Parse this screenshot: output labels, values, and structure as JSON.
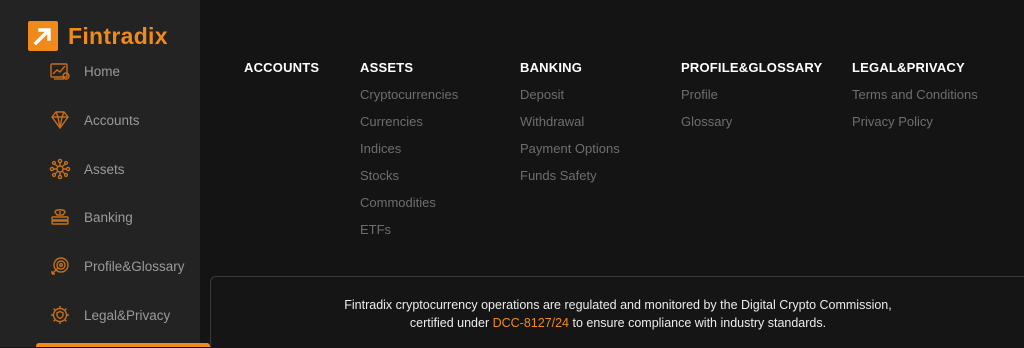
{
  "brand": {
    "name": "Fintradix",
    "accent": "#f08a18"
  },
  "sidebar": {
    "items": [
      {
        "label": "Home",
        "icon": "chart-icon"
      },
      {
        "label": "Accounts",
        "icon": "diamond-icon"
      },
      {
        "label": "Assets",
        "icon": "network-icon"
      },
      {
        "label": "Banking",
        "icon": "money-stack-icon"
      },
      {
        "label": "Profile&Glossary",
        "icon": "profile-target-icon"
      },
      {
        "label": "Legal&Privacy",
        "icon": "gear-shield-icon"
      }
    ]
  },
  "footer_nav": {
    "columns": [
      {
        "title": "ACCOUNTS",
        "links": []
      },
      {
        "title": "ASSETS",
        "links": [
          "Cryptocurrencies",
          "Currencies",
          "Indices",
          "Stocks",
          "Commodities",
          "ETFs"
        ]
      },
      {
        "title": "BANKING",
        "links": [
          "Deposit",
          "Withdrawal",
          "Payment Options",
          "Funds Safety"
        ]
      },
      {
        "title": "PROFILE&GLOSSARY",
        "links": [
          "Profile",
          "Glossary"
        ]
      },
      {
        "title": "LEGAL&PRIVACY",
        "links": [
          "Terms and Conditions",
          "Privacy Policy"
        ]
      }
    ]
  },
  "notice": {
    "line1": "Fintradix cryptocurrency operations are regulated and monitored by the Digital Crypto Commission,",
    "line2_prefix": "certified under ",
    "code": "DCC-8127/24",
    "line2_suffix": " to ensure compliance with industry standards."
  }
}
